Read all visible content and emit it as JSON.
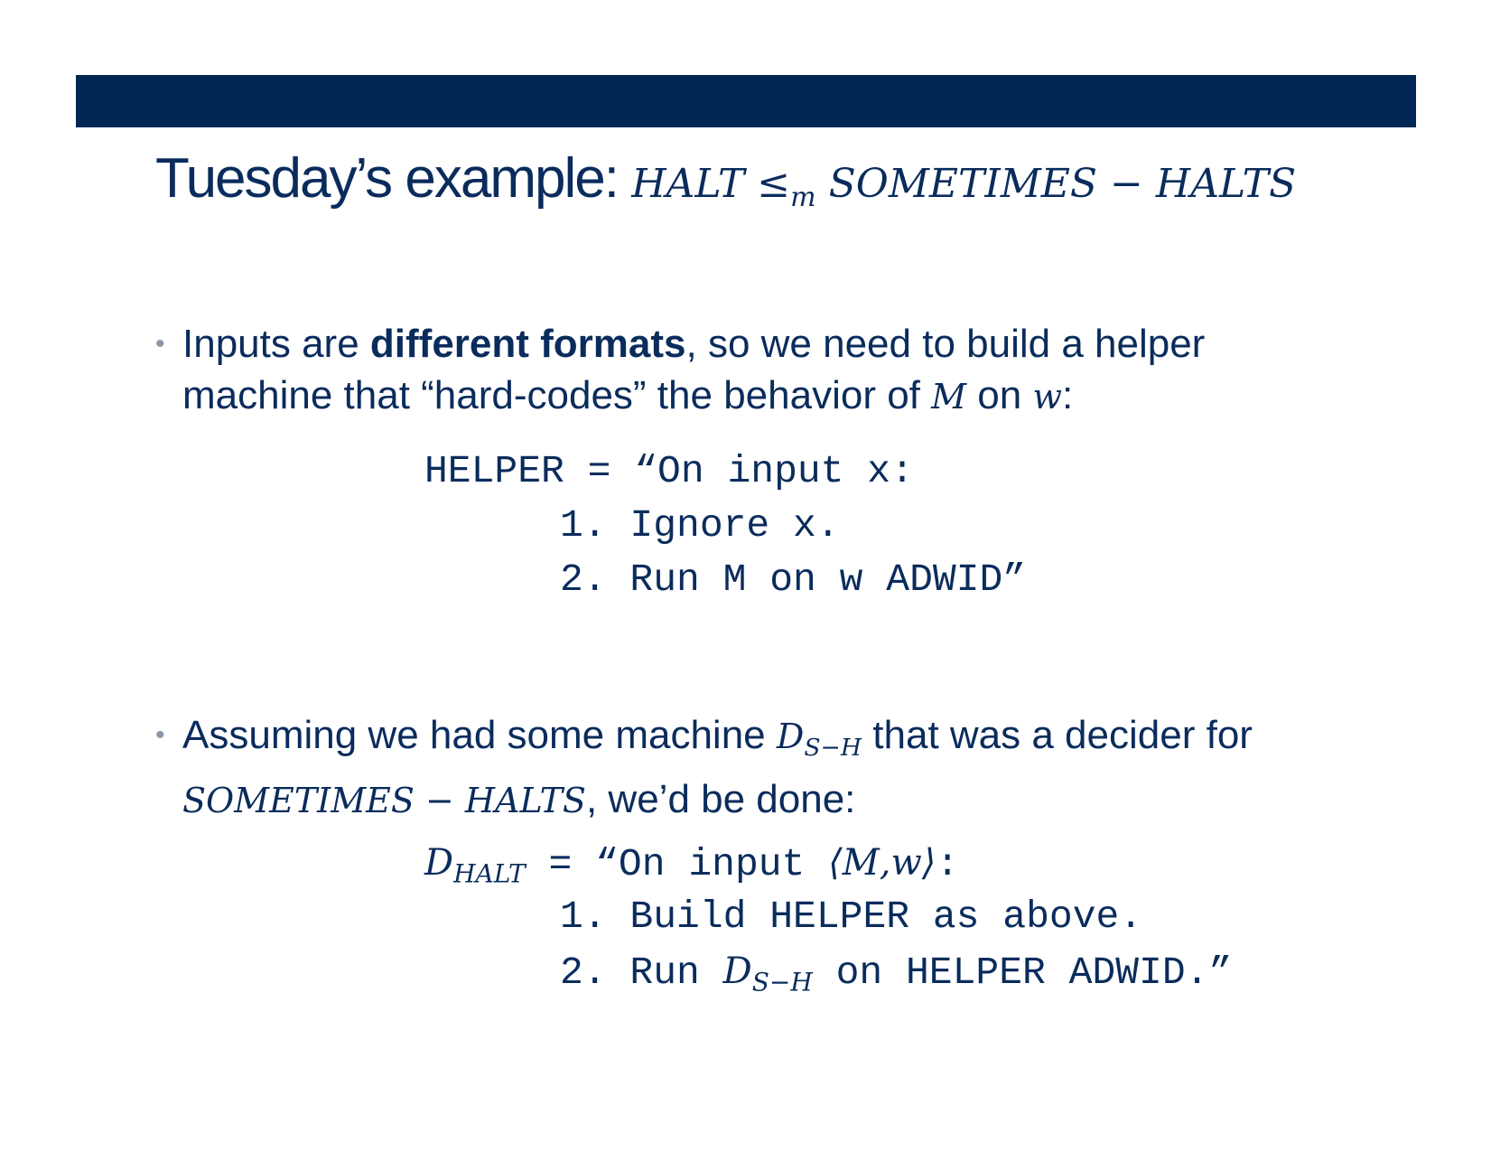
{
  "title": {
    "text": "Tuesday’s example: ",
    "math_left": "HALT ≤",
    "math_sub": "m",
    "math_right": " SOMETIMES − HALTS"
  },
  "bullet1": {
    "marker": "•",
    "p1": "Inputs are ",
    "bold": "different formats",
    "p2": ", so we need to build a helper machine that “hard-codes” the behavior of ",
    "m": "M",
    "p3": " on ",
    "w": "w",
    "p4": ":"
  },
  "helper": {
    "line1": "HELPER = “On input x:",
    "line2": "1. Ignore x.",
    "line3": "2. Run M on w ADWID”"
  },
  "bullet2": {
    "marker": "•",
    "p1": "Assuming we had some machine ",
    "d": "D",
    "d_sub": "S−H",
    "p2": " that was a decider for ",
    "lang": "SOMETIMES − HALTS",
    "p3": ", we’d be done:"
  },
  "dhalt": {
    "d": "D",
    "d_sub": "HALT",
    "line1_rest": " = “On input ",
    "input": "⟨M,w⟩",
    "colon": ":",
    "line2": "1. Build HELPER as above.",
    "line3_a": "2. Run ",
    "line3_d": "D",
    "line3_sub": "S−H",
    "line3_b": " on HELPER ADWID.”"
  }
}
